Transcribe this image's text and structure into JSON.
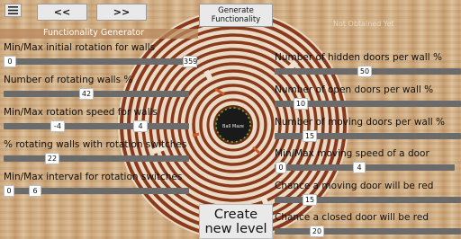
{
  "toolbar": {
    "menu_icon": "hamburger-icon",
    "prev_label": "<<",
    "next_label": ">>",
    "generate_label": "Generate Functionality"
  },
  "left_panel": {
    "title": "Functionality Generator",
    "settings": [
      {
        "label": "Min/Max initial rotation for walls",
        "values": [
          "0",
          "359"
        ]
      },
      {
        "label": "Number of rotating walls %",
        "values": [
          "42"
        ]
      },
      {
        "label": "Min/Max rotation speed for walls",
        "values": [
          "-4",
          "4"
        ]
      },
      {
        "label": "% rotating walls with rotation switches",
        "values": [
          "22"
        ]
      },
      {
        "label": "Min/Max interval for rotation switches",
        "values": [
          "0",
          "6"
        ]
      }
    ]
  },
  "right_panel": {
    "title": "Not Obtained Yet",
    "settings": [
      {
        "label": "Number of hidden doors per wall %",
        "values": [
          "50"
        ]
      },
      {
        "label": "Number of open doors per wall %",
        "values": [
          "10"
        ]
      },
      {
        "label": "Number of moving doors per wall %",
        "values": [
          "15"
        ]
      },
      {
        "label": "Min/Max moving speed of a door",
        "values": [
          "0",
          "4"
        ]
      },
      {
        "label": "Chance a moving door will be red",
        "values": [
          "15"
        ]
      },
      {
        "label": "Chance a closed door will be red",
        "values": [
          "20"
        ]
      }
    ]
  },
  "create_button": {
    "label_line1": "Create",
    "label_line2": "new level"
  },
  "maze_center_text": "Ball Maze",
  "colors": {
    "track": "#6b6b6b",
    "maze_ring": "#8a3a1c",
    "maze_ring_light": "#f1e4d4",
    "panel_header": "#b88a5e"
  }
}
